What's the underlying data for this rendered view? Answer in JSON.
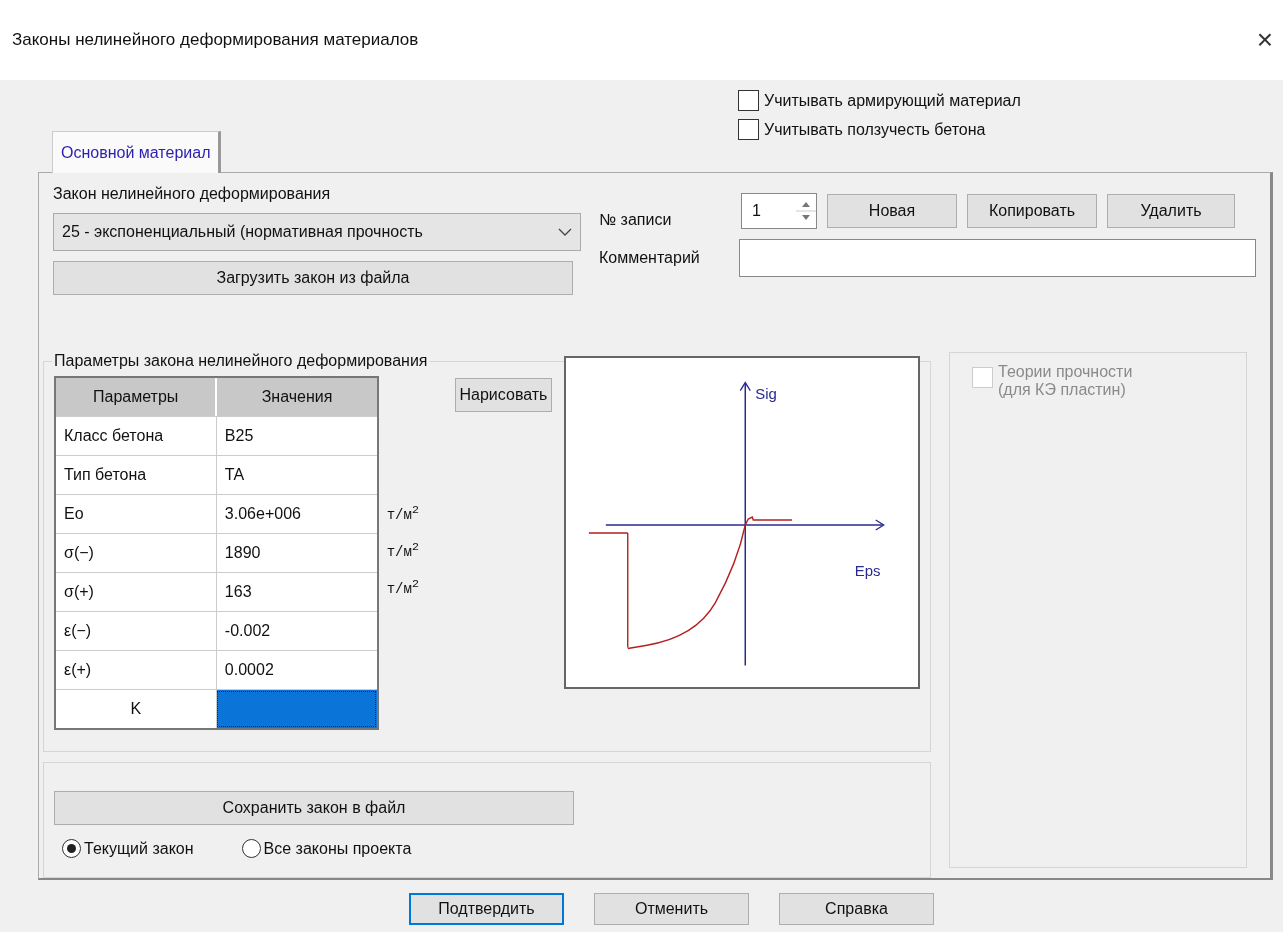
{
  "window": {
    "title": "Законы нелинейного деформирования материалов",
    "close": "×"
  },
  "options": [
    {
      "label": "Учитывать армирующий материал",
      "checked": false
    },
    {
      "label": "Учитывать ползучесть бетона",
      "checked": false
    }
  ],
  "tabs": [
    {
      "label": "Основной материал",
      "selected": true
    }
  ],
  "law": {
    "label": "Закон нелинейного деформирования",
    "value": "25 - экспоненциальный (нормативная прочность",
    "load_button": "Загрузить закон из файла"
  },
  "record": {
    "label": "№ записи",
    "value": "1",
    "buttons": [
      "Новая",
      "Копировать",
      "Удалить"
    ],
    "comment_label": "Комментарий"
  },
  "params": {
    "title": "Параметры закона нелинейного деформирования",
    "columns": [
      "Параметры",
      "Значения"
    ],
    "rows": [
      {
        "name": "Класс бетона",
        "value": "B25",
        "selected": false
      },
      {
        "name": "Тип бетона",
        "value": "TA",
        "selected": false
      },
      {
        "name": "Eo",
        "value": "3.06e+006",
        "unit": "т/м$^{2}$",
        "selected": false
      },
      {
        "name": "σ(−)",
        "value": "1890",
        "unit": "т/м$^{2}$",
        "selected": false
      },
      {
        "name": "σ(+)",
        "value": "163",
        "unit": "т/м$^{2}$",
        "selected": false
      },
      {
        "name": "ε(−)",
        "value": "-0.002",
        "selected": false
      },
      {
        "name": "ε(+)",
        "value": "0.0002",
        "selected": false
      },
      {
        "name": "K",
        "selected": true
      }
    ],
    "draw_button": "Нарисовать",
    "plot": {
      "y_axis": "Sig",
      "x_axis": "Eps"
    }
  },
  "strength": {
    "label": "Теории прочности\n(для КЭ пластин)",
    "checked": false,
    "disabled": true
  },
  "save": {
    "button": "Сохранить закон в файл",
    "scope": [
      {
        "label": "Текущий закон",
        "selected": true
      },
      {
        "label": "Все законы проекта",
        "selected": false
      }
    ]
  },
  "footer": [
    {
      "label": "Подтвердить",
      "default": true
    },
    {
      "label": "Отменить",
      "default": false
    },
    {
      "label": "Справка",
      "default": false
    }
  ]
}
